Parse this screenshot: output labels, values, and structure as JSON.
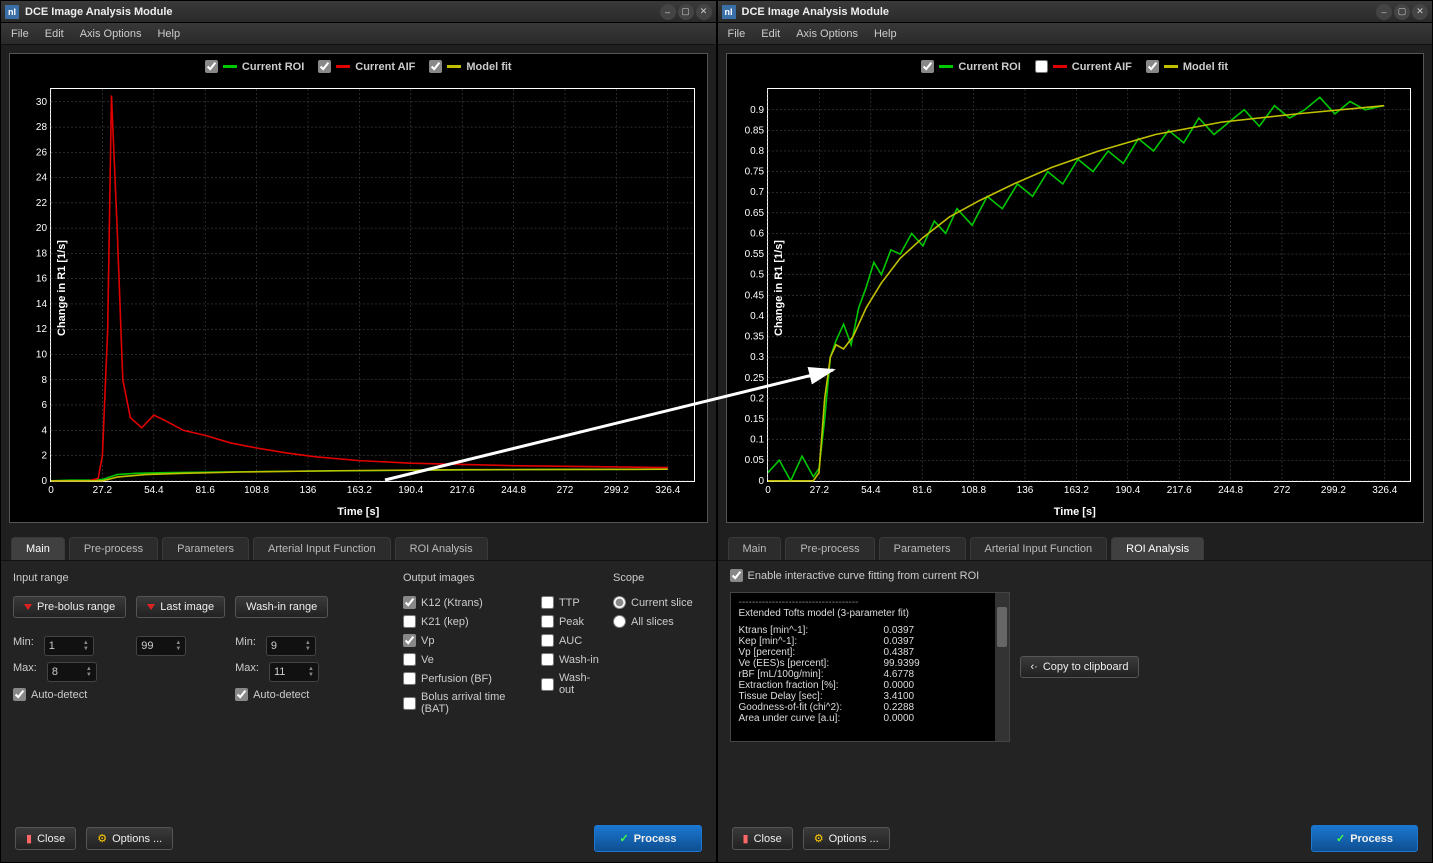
{
  "app": {
    "title": "DCE Image Analysis Module",
    "icon_text": "nI"
  },
  "menu": {
    "file": "File",
    "edit": "Edit",
    "axis": "Axis Options",
    "help": "Help"
  },
  "chart_data": [
    {
      "type": "line",
      "title": "",
      "xlabel": "Time [s]",
      "ylabel": "Change in R1 [1/s]",
      "xlim": [
        0,
        340
      ],
      "ylim": [
        0,
        31
      ],
      "xticks": [
        0,
        27.2,
        54.4,
        81.6,
        108.8,
        136,
        163.2,
        190.4,
        217.6,
        244.8,
        272,
        299.2,
        326.4
      ],
      "yticks": [
        0,
        2,
        4,
        6,
        8,
        10,
        12,
        14,
        16,
        18,
        20,
        22,
        24,
        26,
        28,
        30
      ],
      "series": [
        {
          "name": "Current ROI",
          "color": "#00c800",
          "values": [
            [
              0,
              0
            ],
            [
              10,
              0.05
            ],
            [
              20,
              0.05
            ],
            [
              27,
              0.1
            ],
            [
              35,
              0.5
            ],
            [
              45,
              0.6
            ],
            [
              60,
              0.65
            ],
            [
              90,
              0.7
            ],
            [
              120,
              0.75
            ],
            [
              160,
              0.8
            ],
            [
              200,
              0.85
            ],
            [
              260,
              0.9
            ],
            [
              326,
              0.92
            ]
          ]
        },
        {
          "name": "Current AIF",
          "color": "#e00000",
          "values": [
            [
              0,
              0
            ],
            [
              20,
              0
            ],
            [
              25,
              0.2
            ],
            [
              27.2,
              2
            ],
            [
              30,
              12
            ],
            [
              32,
              30.5
            ],
            [
              35,
              20
            ],
            [
              38,
              8
            ],
            [
              42,
              5
            ],
            [
              48,
              4.2
            ],
            [
              54.4,
              5.2
            ],
            [
              60,
              4.8
            ],
            [
              70,
              4.0
            ],
            [
              81.6,
              3.6
            ],
            [
              95,
              3.0
            ],
            [
              108.8,
              2.6
            ],
            [
              125,
              2.2
            ],
            [
              140,
              1.9
            ],
            [
              163.2,
              1.6
            ],
            [
              190.4,
              1.4
            ],
            [
              217.6,
              1.3
            ],
            [
              244.8,
              1.2
            ],
            [
              272,
              1.15
            ],
            [
              299.2,
              1.1
            ],
            [
              326.4,
              1.05
            ]
          ]
        },
        {
          "name": "Model fit",
          "color": "#c0c000",
          "values": [
            [
              0,
              0
            ],
            [
              27.2,
              0
            ],
            [
              35,
              0.3
            ],
            [
              50,
              0.5
            ],
            [
              70,
              0.6
            ],
            [
              100,
              0.7
            ],
            [
              150,
              0.8
            ],
            [
              220,
              0.88
            ],
            [
              326.4,
              0.92
            ]
          ]
        }
      ],
      "legend_checks": {
        "roi": true,
        "aif": true,
        "fit": true
      }
    },
    {
      "type": "line",
      "title": "",
      "xlabel": "Time [s]",
      "ylabel": "Change in R1 [1/s]",
      "xlim": [
        0,
        340
      ],
      "ylim": [
        0,
        0.95
      ],
      "xticks": [
        0,
        27.2,
        54.4,
        81.6,
        108.8,
        136,
        163.2,
        190.4,
        217.6,
        244.8,
        272,
        299.2,
        326.4
      ],
      "yticks": [
        0,
        0.05,
        0.1,
        0.15,
        0.2,
        0.25,
        0.3,
        0.35,
        0.4,
        0.45,
        0.5,
        0.55,
        0.6,
        0.65,
        0.7,
        0.75,
        0.8,
        0.85,
        0.9
      ],
      "series": [
        {
          "name": "Current ROI",
          "color": "#00c800",
          "values": [
            [
              0,
              0.02
            ],
            [
              6,
              0.05
            ],
            [
              12,
              -0.02
            ],
            [
              18,
              0.06
            ],
            [
              24,
              0.01
            ],
            [
              27,
              0.03
            ],
            [
              30,
              0.15
            ],
            [
              33,
              0.3
            ],
            [
              36,
              0.34
            ],
            [
              40,
              0.38
            ],
            [
              44,
              0.33
            ],
            [
              48,
              0.42
            ],
            [
              52,
              0.47
            ],
            [
              56,
              0.53
            ],
            [
              60,
              0.5
            ],
            [
              65,
              0.56
            ],
            [
              70,
              0.55
            ],
            [
              76,
              0.6
            ],
            [
              82,
              0.57
            ],
            [
              88,
              0.63
            ],
            [
              94,
              0.6
            ],
            [
              100,
              0.66
            ],
            [
              108,
              0.62
            ],
            [
              116,
              0.69
            ],
            [
              124,
              0.66
            ],
            [
              132,
              0.72
            ],
            [
              140,
              0.69
            ],
            [
              148,
              0.75
            ],
            [
              156,
              0.72
            ],
            [
              164,
              0.78
            ],
            [
              172,
              0.75
            ],
            [
              180,
              0.8
            ],
            [
              188,
              0.77
            ],
            [
              196,
              0.83
            ],
            [
              204,
              0.8
            ],
            [
              212,
              0.85
            ],
            [
              220,
              0.82
            ],
            [
              228,
              0.88
            ],
            [
              236,
              0.84
            ],
            [
              244,
              0.87
            ],
            [
              252,
              0.9
            ],
            [
              260,
              0.86
            ],
            [
              268,
              0.91
            ],
            [
              276,
              0.88
            ],
            [
              284,
              0.9
            ],
            [
              292,
              0.93
            ],
            [
              300,
              0.89
            ],
            [
              308,
              0.92
            ],
            [
              316,
              0.9
            ],
            [
              326,
              0.91
            ]
          ]
        },
        {
          "name": "Model fit",
          "color": "#c0c000",
          "values": [
            [
              0,
              0
            ],
            [
              24,
              0
            ],
            [
              27,
              0.02
            ],
            [
              30,
              0.2
            ],
            [
              33,
              0.3
            ],
            [
              36,
              0.33
            ],
            [
              40,
              0.32
            ],
            [
              45,
              0.35
            ],
            [
              52,
              0.42
            ],
            [
              60,
              0.48
            ],
            [
              70,
              0.54
            ],
            [
              82,
              0.59
            ],
            [
              96,
              0.64
            ],
            [
              112,
              0.68
            ],
            [
              130,
              0.72
            ],
            [
              150,
              0.76
            ],
            [
              175,
              0.8
            ],
            [
              205,
              0.84
            ],
            [
              240,
              0.87
            ],
            [
              280,
              0.89
            ],
            [
              326,
              0.91
            ]
          ]
        }
      ],
      "legend_checks": {
        "roi": true,
        "aif": false,
        "fit": true
      }
    }
  ],
  "tabs": {
    "main": "Main",
    "preprocess": "Pre-process",
    "parameters": "Parameters",
    "aif": "Arterial Input Function",
    "roi": "ROI Analysis"
  },
  "leftPanel": {
    "inputRangeTitle": "Input range",
    "preBolus": "Pre-bolus range",
    "lastImage": "Last image",
    "washIn": "Wash-in range",
    "minLabel": "Min:",
    "maxLabel": "Max:",
    "preMin": "1",
    "preMax": "8",
    "lastVal": "99",
    "washMin": "9",
    "washMax": "11",
    "autoDetect": "Auto-detect",
    "outputTitle": "Output images",
    "out": {
      "k12": "K12 (Ktrans)",
      "k21": "K21 (kep)",
      "vp": "Vp",
      "ve": "Ve",
      "perf": "Perfusion (BF)",
      "bat": "Bolus arrival time (BAT)",
      "ttp": "TTP",
      "peak": "Peak",
      "auc": "AUC",
      "washin": "Wash-in",
      "washout": "Wash-out"
    },
    "scopeTitle": "Scope",
    "scopeCurrent": "Current slice",
    "scopeAll": "All slices"
  },
  "rightPanel": {
    "enableFit": "Enable interactive curve fitting from current ROI",
    "model_header": "Extended Tofts model (3-parameter fit)",
    "results": [
      {
        "k": "Ktrans [min^-1]:",
        "v": "0.0397"
      },
      {
        "k": "Kep [min^-1]:",
        "v": "0.0397"
      },
      {
        "k": "Vp [percent]:",
        "v": "0.4387"
      },
      {
        "k": "Ve (EES)s [percent]:",
        "v": "99.9399"
      },
      {
        "k": "rBF [mL/100g/min]:",
        "v": "4.6778"
      },
      {
        "k": "Extraction fraction [%]:",
        "v": "0.0000"
      },
      {
        "k": "Tissue Delay [sec]:",
        "v": "3.4100"
      },
      {
        "k": "Goodness-of-fit (chi^2):",
        "v": "0.2288"
      },
      {
        "k": "Area under curve [a.u]:",
        "v": "0.0000"
      }
    ],
    "copy": "Copy to clipboard"
  },
  "footer": {
    "close": "Close",
    "options": "Options ...",
    "process": "Process"
  },
  "legend": {
    "roi": "Current ROI",
    "aif": "Current AIF",
    "fit": "Model fit"
  }
}
